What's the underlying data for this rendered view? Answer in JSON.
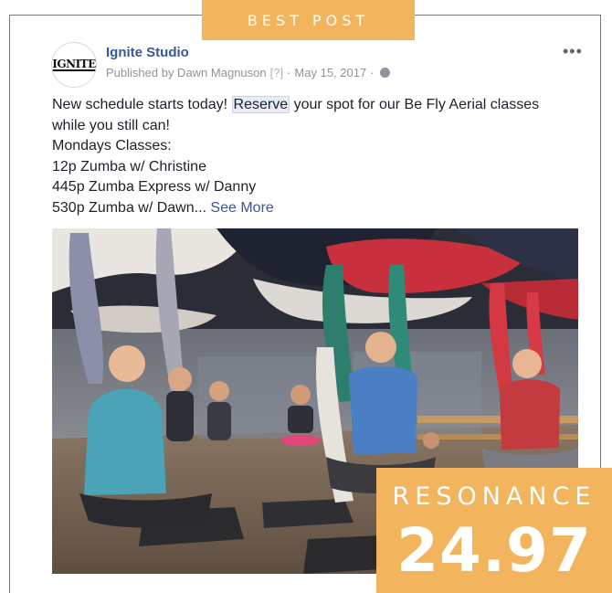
{
  "badge": {
    "label": "BEST POST"
  },
  "post": {
    "page_name": "Ignite Studio",
    "avatar_text": "IGNITE",
    "published_by": "Published by Dawn Magnuson",
    "help_mark": "[?]",
    "separator": "·",
    "date": "May 15, 2017",
    "privacy_icon": "globe-icon",
    "more_options_icon": "more-dots-icon",
    "text": {
      "line1_before": "New schedule starts today! ",
      "line1_highlight": "Reserve",
      "line1_after": " your spot for our Be Fly Aerial classes",
      "line2": "while you still can!",
      "line3": "Mondays Classes:",
      "line4": "12p Zumba w/ Christine",
      "line5": "445p Zumba Express w/ Danny",
      "line6": "530p Zumba w/ Dawn...",
      "see_more": "See More"
    }
  },
  "resonance": {
    "label": "RESONANCE",
    "value": "24.97"
  },
  "colors": {
    "accent": "#f2b45c",
    "link": "#365899",
    "meta": "#90949c",
    "text": "#1d2129"
  }
}
